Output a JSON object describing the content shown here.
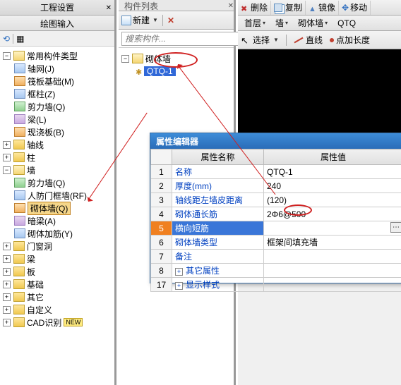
{
  "leftPanel": {
    "title1": "工程设置",
    "title2": "绘图输入",
    "tree": {
      "root": "常用构件类型",
      "under_root": [
        {
          "label": "轴网(J)"
        },
        {
          "label": "筏板基础(M)"
        },
        {
          "label": "框柱(Z)"
        },
        {
          "label": "剪力墙(Q)"
        },
        {
          "label": "梁(L)"
        },
        {
          "label": "现浇板(B)"
        }
      ],
      "siblings": [
        {
          "label": "轴线"
        },
        {
          "label": "柱"
        },
        {
          "label": "墙",
          "expanded": true,
          "children": [
            {
              "label": "剪力墙(Q)"
            },
            {
              "label": "人防门框墙(RF)"
            },
            {
              "label": "砌体墙(Q)",
              "highlight": true
            },
            {
              "label": "暗梁(A)"
            },
            {
              "label": "砌体加筋(Y)"
            }
          ]
        },
        {
          "label": "门窗洞"
        },
        {
          "label": "梁"
        },
        {
          "label": "板"
        },
        {
          "label": "基础"
        },
        {
          "label": "其它"
        },
        {
          "label": "自定义"
        },
        {
          "label": "CAD识别",
          "new": true
        }
      ]
    }
  },
  "midPanel": {
    "header": "构件列表",
    "new_btn": "新建",
    "search_placeholder": "搜索构件...",
    "tree": {
      "root": "砌体墙",
      "child": "QTQ-1"
    }
  },
  "rightPanel": {
    "top_buttons": [
      {
        "label": "删除"
      },
      {
        "label": "复制"
      },
      {
        "label": "镜像"
      },
      {
        "label": "移动"
      }
    ],
    "tabs": [
      "首层",
      "墙",
      "砌体墙",
      "QTQ"
    ],
    "tools2": {
      "select": "选择",
      "line": "直线",
      "point": "点加长度"
    }
  },
  "propEditor": {
    "title": "属性编辑器",
    "col1": "属性名称",
    "col2": "属性值",
    "rows": [
      {
        "n": "1",
        "name": "名称",
        "value": "QTQ-1"
      },
      {
        "n": "2",
        "name": "厚度(mm)",
        "value": "240"
      },
      {
        "n": "3",
        "name": "轴线距左墙皮距离",
        "value": "(120)"
      },
      {
        "n": "4",
        "name": "砌体通长筋",
        "value": "2Φ6@500"
      },
      {
        "n": "5",
        "name": "横向短筋",
        "value": "",
        "sel": true
      },
      {
        "n": "6",
        "name": "砌体墙类型",
        "value": "框架间填充墙"
      },
      {
        "n": "7",
        "name": "备注",
        "value": ""
      },
      {
        "n": "8",
        "name": "其它属性",
        "value": "",
        "expand": true
      },
      {
        "n": "17",
        "name": "显示样式",
        "value": "",
        "expand": true
      }
    ]
  }
}
